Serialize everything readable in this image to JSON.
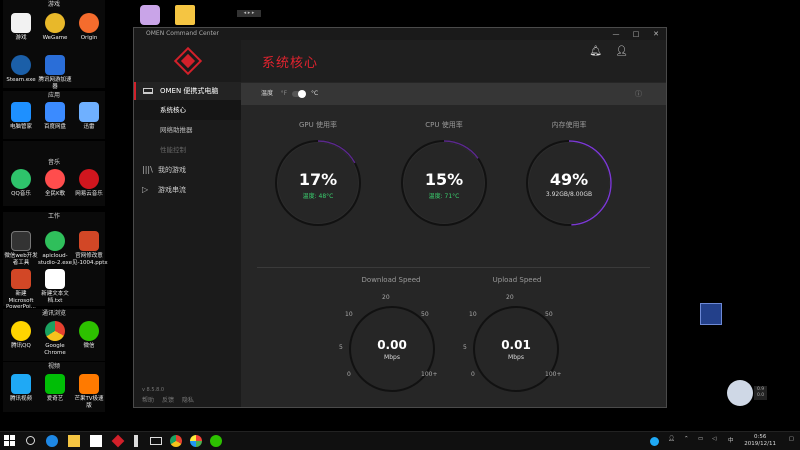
{
  "desktop": {
    "groups": [
      {
        "title": "游戏",
        "icons": [
          {
            "label": "游戏",
            "color": "#ffffff"
          },
          {
            "label": "WeGame",
            "color": "#e8b82a"
          },
          {
            "label": "Origin",
            "color": "#f56c2d"
          },
          {
            "label": "Steam.exe",
            "color": "#1b5fa8"
          },
          {
            "label": "腾讯网游加速器",
            "color": "#2a6ed8"
          }
        ]
      },
      {
        "title": "应用",
        "icons": [
          {
            "label": "电脑管家",
            "color": "#1e90ff"
          },
          {
            "label": "百度网盘",
            "color": "#3b8bff"
          },
          {
            "label": "迅雷",
            "color": "#6fb0ff"
          }
        ]
      },
      {
        "title": "音乐",
        "icons": [
          {
            "label": "QQ音乐",
            "color": "#2ec36b"
          },
          {
            "label": "全民K歌",
            "color": "#ff4d4d"
          },
          {
            "label": "网易云音乐",
            "color": "#d0161e"
          }
        ]
      },
      {
        "title": "工作",
        "icons": [
          {
            "label": "微信web开发者工具",
            "color": "#333333"
          },
          {
            "label": "apicloud-studio-2.exe",
            "color": "#2fbf5b"
          },
          {
            "label": "官网修改意见-1004.pptx",
            "color": "#d24726"
          },
          {
            "label": "新建Microsoft PowerPoi...",
            "color": "#d24726"
          },
          {
            "label": "新建文本文档.txt",
            "color": "#ffffff"
          }
        ]
      },
      {
        "title": "通讯浏览",
        "icons": [
          {
            "label": "腾讯QQ",
            "color": "#ffd400"
          },
          {
            "label": "Google Chrome",
            "color": "#e5412f"
          },
          {
            "label": "微信",
            "color": "#2dc100"
          }
        ]
      },
      {
        "title": "视频",
        "icons": [
          {
            "label": "腾讯视频",
            "color": "#1fa9f5"
          },
          {
            "label": "爱奇艺",
            "color": "#00be06"
          },
          {
            "label": "芒果TV极速版",
            "color": "#ff7a00"
          }
        ]
      }
    ],
    "mini_bar_text": "◂ ▸ ▸"
  },
  "app": {
    "window_title": "OMEN Command Center",
    "win_controls": [
      "—",
      "□",
      "✕"
    ],
    "page_title": "系统核心",
    "nav": {
      "main_label": "OMEN 便携式电脑",
      "sub_items": [
        {
          "label": "系统核心",
          "state": "active"
        },
        {
          "label": "网络助推器",
          "state": "normal"
        },
        {
          "label": "性能控制",
          "state": "disabled"
        }
      ],
      "items": [
        {
          "label": "我的游戏",
          "icon": "library-icon",
          "glyph": "|||\\"
        },
        {
          "label": "游戏串流",
          "icon": "stream-icon",
          "glyph": "▷"
        }
      ],
      "version": "v 8.5.8.0",
      "footer_links": [
        "帮助",
        "反馈",
        "隐私"
      ]
    },
    "temperature": {
      "label": "温度",
      "unit_f": "°F",
      "unit_c": "°C",
      "selected": "°C"
    },
    "gauges": [
      {
        "title": "GPU 使用率",
        "value": "17%",
        "sub": "温度: 48°C",
        "percent": 17
      },
      {
        "title": "CPU 使用率",
        "value": "15%",
        "sub": "温度: 71°C",
        "percent": 15
      },
      {
        "title": "内存使用率",
        "value": "49%",
        "sub": "3.92GB/8.00GB",
        "percent": 49
      }
    ],
    "speeds": [
      {
        "title": "Download Speed",
        "value": "0.00",
        "unit": "Mbps"
      },
      {
        "title": "Upload Speed",
        "value": "0.01",
        "unit": "Mbps"
      }
    ],
    "speed_ticks": [
      "0",
      "5",
      "10",
      "20",
      "50",
      "100+"
    ],
    "accent": "#e2232f"
  },
  "network_widget": {
    "up": "0.9",
    "down": "0.0"
  },
  "taskbar": {
    "time": "0:56",
    "date": "2019/12/11",
    "ime": "中"
  }
}
